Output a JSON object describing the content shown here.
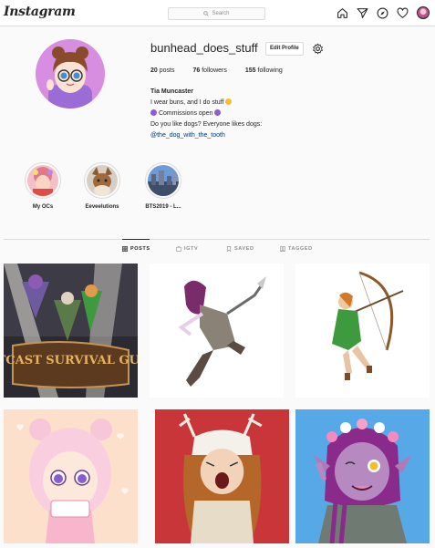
{
  "header": {
    "logo": "Instagram",
    "search_placeholder": "Search",
    "nav_icons": [
      "home-icon",
      "direct-icon",
      "explore-icon",
      "activity-icon",
      "profile-avatar"
    ]
  },
  "profile": {
    "username": "bunhead_does_stuff",
    "edit_label": "Edit Profile",
    "stats": {
      "posts": "20",
      "posts_label": "posts",
      "followers": "76",
      "followers_label": "followers",
      "following": "155",
      "following_label": "following"
    },
    "bio": {
      "name": "Tia Muncaster",
      "line1": "I wear buns, and I do stuff",
      "line2": "Commissions open",
      "line3": "Do you like dogs? Everyone likes dogs:",
      "link": "@the_dog_with_the_tooth"
    }
  },
  "highlights": [
    {
      "label": "My OCs"
    },
    {
      "label": "Eeveelutions"
    },
    {
      "label": "BTS2019 - L..."
    }
  ],
  "tabs": [
    {
      "label": "POSTS",
      "icon": "grid-icon",
      "active": true
    },
    {
      "label": "IGTV",
      "icon": "igtv-icon",
      "active": false
    },
    {
      "label": "SAVED",
      "icon": "bookmark-icon",
      "active": false
    },
    {
      "label": "TAGGED",
      "icon": "tag-icon",
      "active": false
    }
  ],
  "posts": [
    {
      "caption_text": "OUTCAST SURVIVAL GUIDE"
    },
    {
      "caption_text": ""
    },
    {
      "caption_text": ""
    },
    {
      "caption_text": ""
    },
    {
      "caption_text": ""
    },
    {
      "caption_text": ""
    }
  ],
  "colors": {
    "link": "#00376b",
    "border": "#dbdbdb",
    "text": "#262626",
    "muted": "#8e8e8e",
    "background": "#fafafa"
  }
}
